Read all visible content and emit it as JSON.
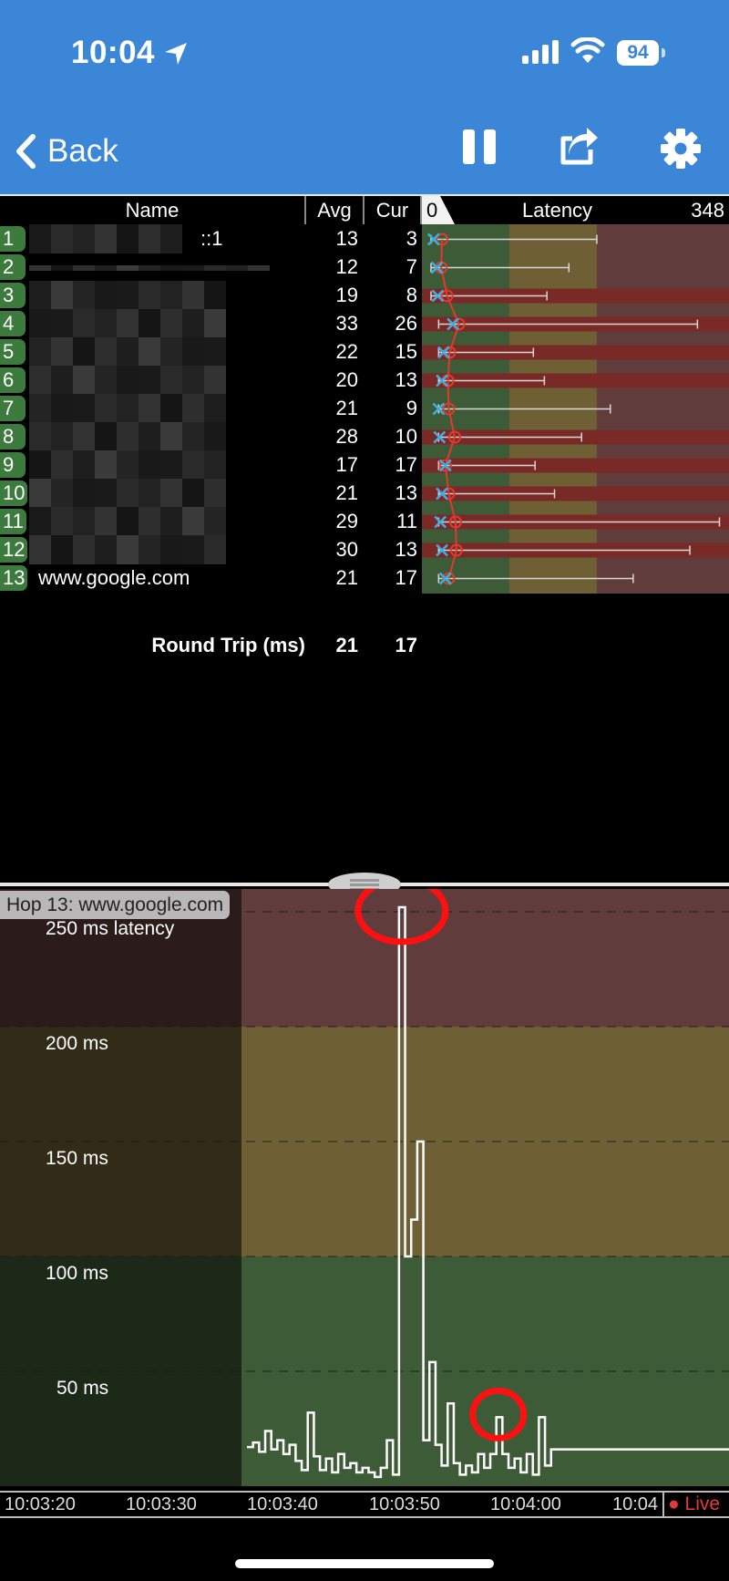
{
  "status_bar": {
    "time": "10:04",
    "battery": "94",
    "icons": [
      "location-arrow-icon",
      "signal-icon",
      "wifi-icon",
      "battery-icon"
    ]
  },
  "nav": {
    "back_label": "Back",
    "icons": [
      "chevron-left-icon",
      "pause-icon",
      "share-icon",
      "gear-icon"
    ]
  },
  "table": {
    "headers": {
      "name": "Name",
      "avg": "Avg",
      "cur": "Cur",
      "latency": "Latency",
      "latency_min": "0",
      "latency_max": "348"
    },
    "rows": [
      {
        "hop": "1",
        "name": "::1",
        "avg": "13",
        "cur": "3",
        "min": 0,
        "max": 196,
        "avg_v": 13,
        "cur_v": 3,
        "worst": false
      },
      {
        "hop": "2",
        "name": "",
        "avg": "12",
        "cur": "7",
        "min": 0,
        "max": 163,
        "avg_v": 12,
        "cur_v": 7,
        "worst": false
      },
      {
        "hop": "3",
        "name": "",
        "avg": "19",
        "cur": "8",
        "min": 0,
        "max": 137,
        "avg_v": 19,
        "cur_v": 8,
        "worst": true
      },
      {
        "hop": "4",
        "name": "",
        "avg": "33",
        "cur": "26",
        "min": 9,
        "max": 315,
        "avg_v": 33,
        "cur_v": 26,
        "worst": true
      },
      {
        "hop": "5",
        "name": "",
        "avg": "22",
        "cur": "15",
        "min": 9,
        "max": 121,
        "avg_v": 22,
        "cur_v": 15,
        "worst": true
      },
      {
        "hop": "6",
        "name": "",
        "avg": "20",
        "cur": "13",
        "min": 9,
        "max": 134,
        "avg_v": 20,
        "cur_v": 13,
        "worst": true
      },
      {
        "hop": "7",
        "name": "",
        "avg": "21",
        "cur": "9",
        "min": 9,
        "max": 212,
        "avg_v": 21,
        "cur_v": 9,
        "worst": false
      },
      {
        "hop": "8",
        "name": "",
        "avg": "28",
        "cur": "10",
        "min": 9,
        "max": 178,
        "avg_v": 28,
        "cur_v": 10,
        "worst": true
      },
      {
        "hop": "9",
        "name": "",
        "avg": "17",
        "cur": "17",
        "min": 9,
        "max": 123,
        "avg_v": 17,
        "cur_v": 17,
        "worst": true
      },
      {
        "hop": "10",
        "name": "",
        "avg": "21",
        "cur": "13",
        "min": 9,
        "max": 146,
        "avg_v": 21,
        "cur_v": 13,
        "worst": true
      },
      {
        "hop": "11",
        "name": "",
        "avg": "29",
        "cur": "11",
        "min": 9,
        "max": 341,
        "avg_v": 29,
        "cur_v": 11,
        "worst": true
      },
      {
        "hop": "12",
        "name": "",
        "avg": "30",
        "cur": "13",
        "min": 9,
        "max": 306,
        "avg_v": 30,
        "cur_v": 13,
        "worst": true
      },
      {
        "hop": "13",
        "name": "www.google.com",
        "avg": "21",
        "cur": "17",
        "min": 9,
        "max": 239,
        "avg_v": 21,
        "cur_v": 17,
        "worst": false
      }
    ],
    "round_trip": {
      "label": "Round Trip (ms)",
      "avg": "21",
      "cur": "17"
    }
  },
  "chart_panel": {
    "hop_label": "Hop 13: www.google.com",
    "y_labels": [
      "250 ms latency",
      "200 ms",
      "150 ms",
      "100 ms",
      "50 ms"
    ],
    "x_ticks": [
      "10:03:20",
      "10:03:30",
      "10:03:40",
      "10:03:50",
      "10:04:00",
      "10:04"
    ],
    "live_label": "● Live"
  },
  "colors": {
    "status_bar": "#3b86d6",
    "zone_good": "#3e5b38",
    "zone_warn": "#6e6034",
    "zone_bad": "#613c3c",
    "hop_badge": "#3d7a3d",
    "marker_avg": "#e23a2a",
    "marker_cur": "#3ab0e6",
    "annotation": "#ff1010",
    "live": "#e23a3a"
  },
  "chart_data": {
    "type": "line",
    "x_label": "",
    "y_label": "",
    "ylim": [
      0,
      250
    ],
    "x_range": [
      "10:03:20",
      "10:04:05"
    ],
    "series": [
      {
        "values": [
          [
            "10:03:40",
            17
          ],
          [
            "10:03:40.5",
            19
          ],
          [
            "10:03:41",
            15
          ],
          [
            "10:03:41.5",
            24
          ],
          [
            "10:03:42",
            16
          ],
          [
            "10:03:42.5",
            20
          ],
          [
            "10:03:43",
            14
          ],
          [
            "10:03:43.5",
            18
          ],
          [
            "10:03:44",
            11
          ],
          [
            "10:03:44.5",
            7
          ],
          [
            "10:03:45",
            32
          ],
          [
            "10:03:45.5",
            13
          ],
          [
            "10:03:46",
            7
          ],
          [
            "10:03:46.5",
            12
          ],
          [
            "10:03:47",
            6
          ],
          [
            "10:03:47.5",
            14
          ],
          [
            "10:03:48",
            8
          ],
          [
            "10:03:48.5",
            10
          ],
          [
            "10:03:49",
            6
          ],
          [
            "10:03:49.5",
            8
          ],
          [
            "10:03:50",
            6
          ],
          [
            "10:03:50.5",
            4
          ],
          [
            "10:03:51",
            8
          ],
          [
            "10:03:51.5",
            20
          ],
          [
            "10:03:52",
            5
          ],
          [
            "10:03:52.5",
            252
          ],
          [
            "10:03:53",
            100
          ],
          [
            "10:03:53.5",
            116
          ],
          [
            "10:03:54",
            150
          ],
          [
            "10:03:54.5",
            20
          ],
          [
            "10:03:55",
            54
          ],
          [
            "10:03:55.5",
            18
          ],
          [
            "10:03:56",
            9
          ],
          [
            "10:03:56.5",
            36
          ],
          [
            "10:03:57",
            10
          ],
          [
            "10:03:57.5",
            5
          ],
          [
            "10:03:58",
            9
          ],
          [
            "10:03:58.5",
            6
          ],
          [
            "10:03:59",
            14
          ],
          [
            "10:03:59.5",
            8
          ],
          [
            "10:04:00",
            14
          ],
          [
            "10:04:00.5",
            30
          ],
          [
            "10:04:01",
            14
          ],
          [
            "10:04:01.5",
            8
          ],
          [
            "10:04:02",
            12
          ],
          [
            "10:04:02.5",
            6
          ],
          [
            "10:04:03",
            14
          ],
          [
            "10:04:03.5",
            5
          ],
          [
            "10:04:04",
            30
          ],
          [
            "10:04:04.5",
            9
          ],
          [
            "10:04:05",
            16
          ]
        ]
      }
    ],
    "zones": [
      {
        "name": "good",
        "from": 0,
        "to": 100
      },
      {
        "name": "warning",
        "from": 100,
        "to": 200
      },
      {
        "name": "bad",
        "from": 200,
        "to": 250
      }
    ],
    "grid": true,
    "annotations": [
      {
        "type": "circle",
        "x": "10:03:52.5",
        "y": 252
      },
      {
        "type": "circle",
        "x": "10:04:00.5",
        "y": 30
      }
    ]
  }
}
